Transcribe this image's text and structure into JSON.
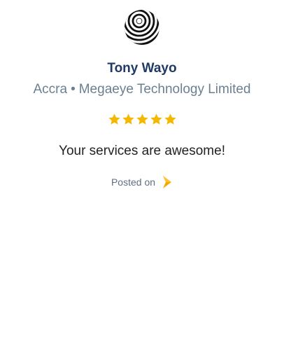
{
  "review": {
    "reviewer_name": "Tony Wayo",
    "location": "Accra",
    "separator": "•",
    "company": "Megaeye Technology Limited",
    "rating": 5,
    "rating_max": 5,
    "text": "Your services are awesome!",
    "posted_on_label": "Posted on"
  },
  "icons": {
    "logo": "striped-sphere-logo",
    "star": "star-icon",
    "source": "source-chevron-icon"
  },
  "colors": {
    "name": "#1f3a64",
    "meta": "#6b7f91",
    "star": "#f5b800",
    "text": "#222222",
    "source_icon": "#f7a700"
  }
}
